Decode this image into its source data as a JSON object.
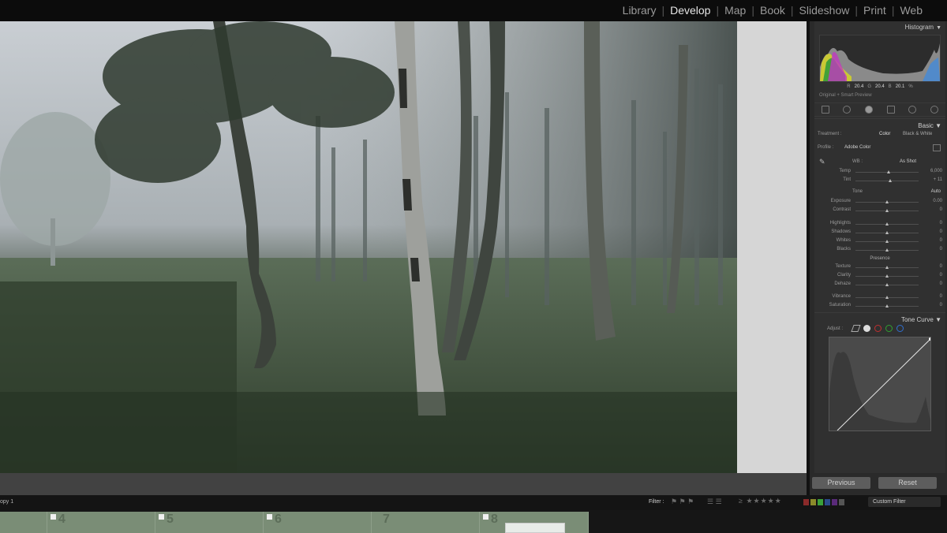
{
  "modules": [
    "Library",
    "Develop",
    "Map",
    "Book",
    "Slideshow",
    "Print",
    "Web"
  ],
  "active_module": "Develop",
  "histogram": {
    "title": "Histogram",
    "r_label": "R",
    "r_value": "20.4",
    "g_label": "G",
    "g_value": "20.4",
    "b_label": "B",
    "b_value": "20.1",
    "unit": "%",
    "preview_label": "Original + Smart Preview"
  },
  "basic": {
    "title": "Basic",
    "treatment_label": "Treatment :",
    "treatment_color": "Color",
    "treatment_bw": "Black & White",
    "profile_label": "Profile :",
    "profile_value": "Adobe Color",
    "wb_label": "WB :",
    "wb_value": "As Shot",
    "tone_label": "Tone",
    "auto_label": "Auto",
    "presence_label": "Presence",
    "sliders": [
      {
        "label": "Temp",
        "value": "6,000",
        "pos": 0.52
      },
      {
        "label": "Tint",
        "value": "+ 11",
        "pos": 0.55
      },
      {
        "label": "Exposure",
        "value": "0.00",
        "pos": 0.5
      },
      {
        "label": "Contrast",
        "value": "0",
        "pos": 0.5
      },
      {
        "label": "Highlights",
        "value": "0",
        "pos": 0.5
      },
      {
        "label": "Shadows",
        "value": "0",
        "pos": 0.5
      },
      {
        "label": "Whites",
        "value": "0",
        "pos": 0.5
      },
      {
        "label": "Blacks",
        "value": "0",
        "pos": 0.5
      },
      {
        "label": "Texture",
        "value": "0",
        "pos": 0.5
      },
      {
        "label": "Clarity",
        "value": "0",
        "pos": 0.5
      },
      {
        "label": "Dehaze",
        "value": "0",
        "pos": 0.5
      },
      {
        "label": "Vibrance",
        "value": "0",
        "pos": 0.5
      },
      {
        "label": "Saturation",
        "value": "0",
        "pos": 0.5
      }
    ]
  },
  "tone_curve": {
    "title": "Tone Curve",
    "adjust_label": "Adjust :"
  },
  "buttons": {
    "previous": "Previous",
    "reset": "Reset"
  },
  "filmbar": {
    "copy_label": "opy 1",
    "filter_label": "Filter :",
    "custom_filter": "Custom Filter"
  },
  "filmstrip": {
    "frames": [
      "4",
      "5",
      "6",
      "7",
      "8"
    ]
  },
  "colors": {
    "accent_active": "#e6e6e6",
    "panel_bg": "#303030",
    "filmstrip_thumb": "#7a8d76"
  }
}
